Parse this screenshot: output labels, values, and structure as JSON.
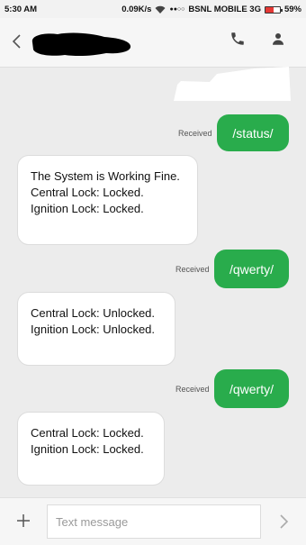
{
  "status_bar": {
    "time": "5:30 AM",
    "speed": "0.09K/s",
    "signal": "●●○○",
    "carrier": "BSNL MOBILE 3G",
    "battery_percent": "59%",
    "battery_level": 0.59,
    "battery_color": "#e53935"
  },
  "header": {
    "back_icon": "chevron-left-icon",
    "call_icon": "phone-icon",
    "contact_icon": "person-icon"
  },
  "messages": [
    {
      "direction": "outgoing",
      "status": "Received",
      "text": "/status/"
    },
    {
      "direction": "incoming",
      "lines": [
        "The System is Working Fine.",
        "Central Lock: Locked.",
        "Ignition Lock: Locked."
      ]
    },
    {
      "direction": "outgoing",
      "status": "Received",
      "text": "/qwerty/"
    },
    {
      "direction": "incoming",
      "lines": [
        "Central Lock: Unlocked.",
        "Ignition Lock: Unlocked."
      ]
    },
    {
      "direction": "outgoing",
      "status": "Received",
      "text": "/qwerty/"
    },
    {
      "direction": "incoming",
      "lines": [
        "Central Lock: Locked.",
        "Ignition Lock: Locked."
      ]
    }
  ],
  "composer": {
    "placeholder": "Text message",
    "add_icon": "plus-icon",
    "send_icon": "send-icon"
  },
  "colors": {
    "outgoing_bubble": "#29ac4c",
    "incoming_bubble": "#ffffff",
    "background": "#ececec"
  }
}
